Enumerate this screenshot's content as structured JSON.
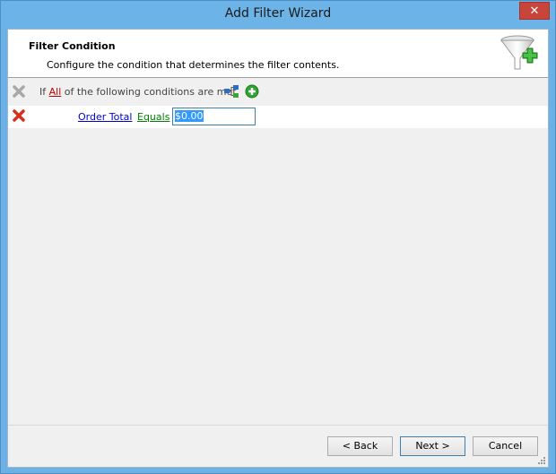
{
  "window": {
    "title": "Add Filter Wizard",
    "close_label": "✕"
  },
  "header": {
    "title": "Filter Condition",
    "description": "Configure the condition that determines the filter contents."
  },
  "condition_group": {
    "prefix": "If",
    "quantifier": "All",
    "suffix": "of the following conditions are met"
  },
  "conditions": [
    {
      "field": "Order Total",
      "operator": "Equals",
      "value": "$0.00"
    }
  ],
  "buttons": {
    "back": "< Back",
    "next": "Next >",
    "cancel": "Cancel"
  },
  "colors": {
    "field_link": "#0000cc",
    "operator_link": "#008000",
    "quantifier_link": "#c00000"
  }
}
